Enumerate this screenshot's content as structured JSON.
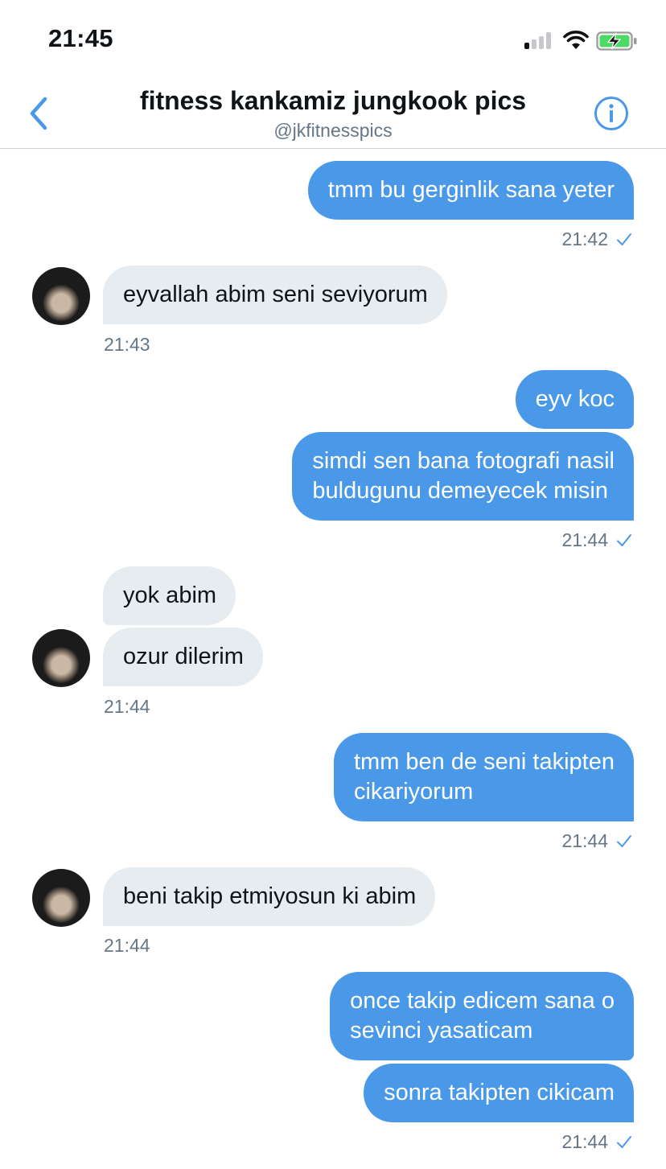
{
  "status_bar": {
    "time": "21:45"
  },
  "header": {
    "title": "fitness kankamiz jungkook pics",
    "handle": "@jkfitnesspics",
    "back_icon": "chevron-left-icon",
    "info_icon": "info-icon"
  },
  "colors": {
    "accent": "#4a99e9",
    "incoming_bubble": "#e6ecf0",
    "muted": "#657786"
  },
  "messages": [
    {
      "dir": "out",
      "text": "tmm bu gerginlik sana yeter"
    },
    {
      "dir": "in",
      "text": "eyvallah abim seni seviyorum"
    },
    {
      "dir": "out",
      "text": "eyv koc"
    },
    {
      "dir": "out",
      "text": "simdi sen bana fotografi nasil\nbuldugunu demeyecek misin"
    },
    {
      "dir": "in",
      "text": "yok abim"
    },
    {
      "dir": "in",
      "text": "ozur dilerim"
    },
    {
      "dir": "out",
      "text": "tmm ben de seni takipten\ncikariyorum"
    },
    {
      "dir": "in",
      "text": "beni takip etmiyosun ki abim"
    },
    {
      "dir": "out",
      "text": "once takip edicem sana o\nsevinci yasaticam"
    },
    {
      "dir": "out",
      "text": "sonra takipten cikicam"
    }
  ],
  "timestamps": [
    "21:42",
    "21:43",
    "21:44",
    "21:44",
    "21:44",
    "21:44",
    "21:44"
  ]
}
